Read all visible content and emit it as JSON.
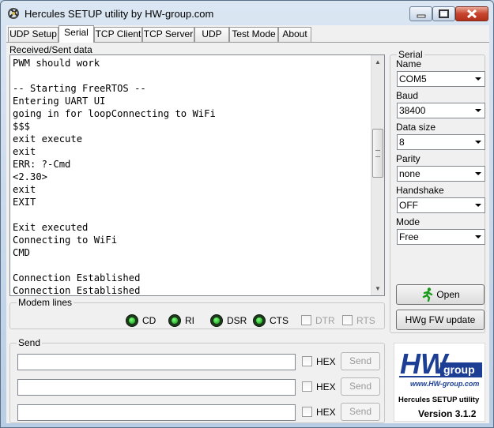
{
  "window": {
    "title": "Hercules SETUP utility by HW-group.com"
  },
  "tabs": [
    {
      "label": "UDP Setup",
      "active": false
    },
    {
      "label": "Serial",
      "active": true
    },
    {
      "label": "TCP Client",
      "active": false
    },
    {
      "label": "TCP Server",
      "active": false
    },
    {
      "label": "UDP",
      "active": false
    },
    {
      "label": "Test Mode",
      "active": false
    },
    {
      "label": "About",
      "active": false
    }
  ],
  "received": {
    "label": "Received/Sent data",
    "text": "PWM should work\n\n-- Starting FreeRTOS --\nEntering UART UI\ngoing in for loopConnecting to WiFi\n$$$\nexit execute\nexit\nERR: ?-Cmd\n<2.30>\nexit\nEXIT\n\nExit executed\nConnecting to WiFi\nCMD\n\nConnection Established\nConnection Established"
  },
  "modem": {
    "label": "Modem lines",
    "leds": [
      "CD",
      "RI",
      "DSR",
      "CTS"
    ],
    "checks": [
      "DTR",
      "RTS"
    ]
  },
  "send": {
    "label": "Send",
    "hex_label": "HEX",
    "button_label": "Send",
    "rows": [
      "",
      "",
      ""
    ]
  },
  "serial": {
    "label": "Serial",
    "name_label": "Name",
    "name_value": "COM5",
    "baud_label": "Baud",
    "baud_value": "38400",
    "datasize_label": "Data size",
    "datasize_value": "8",
    "parity_label": "Parity",
    "parity_value": "none",
    "handshake_label": "Handshake",
    "handshake_value": "OFF",
    "mode_label": "Mode",
    "mode_value": "Free",
    "open_label": "Open",
    "fw_update_label": "HWg FW update"
  },
  "logo": {
    "brand": "HW",
    "brand_suffix": "group",
    "url": "www.HW-group.com",
    "product": "Hercules SETUP utility",
    "version": "Version  3.1.2"
  },
  "colors": {
    "logo_blue": "#1c3f95",
    "led_green": "#0b9a0b"
  }
}
